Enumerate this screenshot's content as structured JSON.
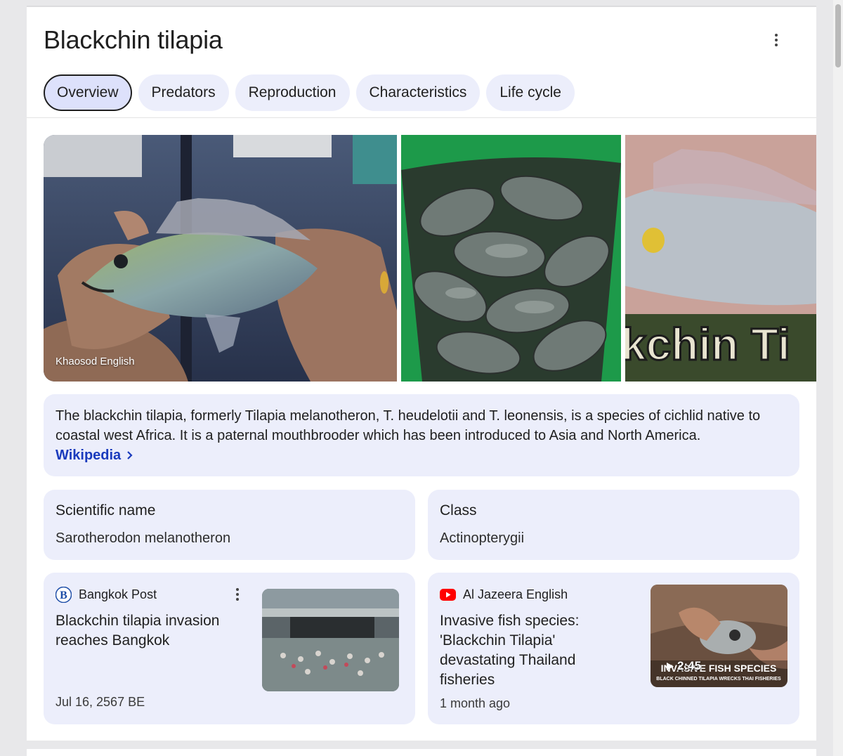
{
  "title": "Blackchin tilapia",
  "tabs": [
    {
      "label": "Overview",
      "active": true
    },
    {
      "label": "Predators",
      "active": false
    },
    {
      "label": "Reproduction",
      "active": false
    },
    {
      "label": "Characteristics",
      "active": false
    },
    {
      "label": "Life cycle",
      "active": false
    }
  ],
  "gallery": {
    "photos": [
      {
        "caption": "Khaosod English"
      },
      {
        "caption": ""
      },
      {
        "caption": "",
        "overlay_text": "kchin Ti"
      }
    ]
  },
  "description": {
    "text": "The blackchin tilapia, formerly Tilapia melanotheron, T. heudelotii and T. leonensis, is a species of cichlid native to coastal west Africa. It is a paternal mouthbrooder which has been introduced to Asia and North America.",
    "source_link": "Wikipedia",
    "source_link_icon": "chevron-right-icon"
  },
  "facts": [
    {
      "label": "Scientific name",
      "value": "Sarotherodon melanotheron"
    },
    {
      "label": "Class",
      "value": "Actinopterygii"
    }
  ],
  "news": [
    {
      "source": "Bangkok Post",
      "source_icon": "bangkok-post-logo-icon",
      "title": "Blackchin tilapia invasion reaches Bangkok",
      "date": "Jul 16, 2567 BE"
    },
    {
      "source": "Al Jazeera English",
      "source_icon": "youtube-icon",
      "title": "Invasive fish species: 'Blackchin Tilapia' devastating Thailand fisheries",
      "date": "1 month ago",
      "video_duration": "2:45",
      "thumb_text": "INVASIVE FISH SPECIES",
      "thumb_subtext": "BLACK CHINNED TILAPIA WRECKS THAI FISHERIES"
    }
  ],
  "colors": {
    "chip_bg": "#eceefb",
    "chip_active_bg": "#dde1fb",
    "link": "#1a3bbd"
  }
}
